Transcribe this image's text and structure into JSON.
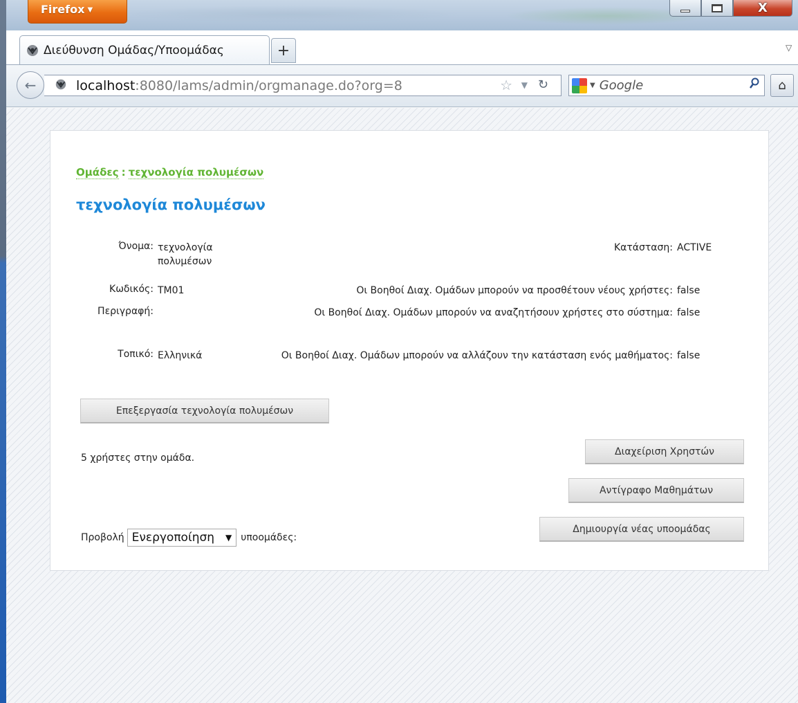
{
  "browser": {
    "menu_button": "Firefox",
    "tab_title": "Διεύθυνση Ομάδας/Υποομάδας",
    "new_tab_label": "+",
    "url_host": "localhost",
    "url_rest": ":8080/lams/admin/orgmanage.do?org=8",
    "search_engine": "Google",
    "window_close": "X"
  },
  "breadcrumb": {
    "root": "Ομάδες",
    "separator": ":",
    "current": "τεχνολογία πολυμέσων"
  },
  "page_title": "τεχνολογία πολυμέσων",
  "details": {
    "name_label": "Όνομα:",
    "name_value": "τεχνολογία πολυμέσων",
    "code_label": "Κωδικός:",
    "code_value": "TM01",
    "description_label": "Περιγραφή:",
    "description_value": "",
    "locale_label": "Τοπικό:",
    "locale_value": "Ελληνικά"
  },
  "settings": {
    "status_label": "Κατάσταση:",
    "status_value": "ACTIVE",
    "add_users_label": "Οι Βοηθοί Διαχ. Ομάδων μπορούν να προσθέτουν νέους χρήστες:",
    "add_users_value": "false",
    "search_users_label": "Οι Βοηθοί Διαχ. Ομάδων μπορούν να αναζητήσουν χρήστες στο σύστημα:",
    "search_users_value": "false",
    "change_status_label": "Οι Βοηθοί Διαχ. Ομάδων μπορούν να αλλάζουν την κατάσταση ενός μαθήματος:",
    "change_status_value": "false"
  },
  "actions": {
    "edit_button": "Επεξεργασία τεχνολογία πολυμέσων",
    "manage_users_button": "Διαχείριση Χρηστών",
    "clone_lessons_button": "Αντίγραφο Μαθημάτων",
    "create_subgroup_button": "Δημιουργία νέας υποομάδας"
  },
  "users_count_text": "5 χρήστες στην ομάδα.",
  "subgroup_filter": {
    "prefix": "Προβολή",
    "selected": "Ενεργοποίηση",
    "suffix": "υποομάδες:"
  },
  "colors": {
    "breadcrumb": "#61b534",
    "title": "#1e88d8",
    "firefox_button": "#e96d12"
  }
}
